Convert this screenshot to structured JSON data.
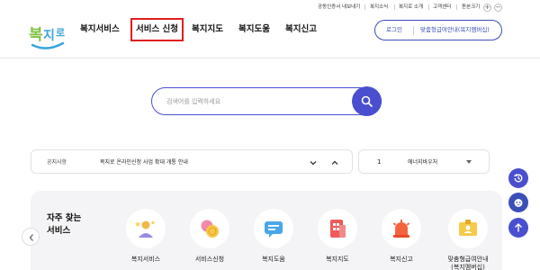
{
  "utility": {
    "links": [
      "공동인증서 내보내기",
      "복지소식",
      "복지로 소개",
      "고객센터",
      "돋본크기"
    ],
    "zoom_in": "+",
    "zoom_out": "−"
  },
  "logo": {
    "text": "복지로"
  },
  "nav": {
    "items": [
      "복지서비스",
      "서비스 신청",
      "복지지도",
      "복지도움",
      "복지신고"
    ],
    "active_index": 1
  },
  "header": {
    "login": "로그인",
    "welfare_guide": "맞춤형급여안내(복지멤버십)"
  },
  "search": {
    "placeholder": "검색어를 입력하세요",
    "value": ""
  },
  "notice": {
    "label": "공지사항",
    "text": "복지로 온라인신청 사업 확대 개통 안내"
  },
  "pager": {
    "number": "1",
    "name": "에너지바우처"
  },
  "frequent": {
    "title": "자주 찾는\n서비스",
    "services": [
      {
        "label": "복지서비스",
        "icon": "person-stars-icon"
      },
      {
        "label": "서비스신청",
        "icon": "coins-icon"
      },
      {
        "label": "복지도움",
        "icon": "chat-bubble-icon"
      },
      {
        "label": "복지지도",
        "icon": "map-icon"
      },
      {
        "label": "복지신고",
        "icon": "siren-icon"
      },
      {
        "label": "맞춤형급여안내\n(복지멤버십)",
        "icon": "id-card-icon"
      }
    ]
  },
  "colors": {
    "accent": "#4a4fcf",
    "active_outline": "#e01e1e",
    "panel": "#f4f4f6"
  }
}
